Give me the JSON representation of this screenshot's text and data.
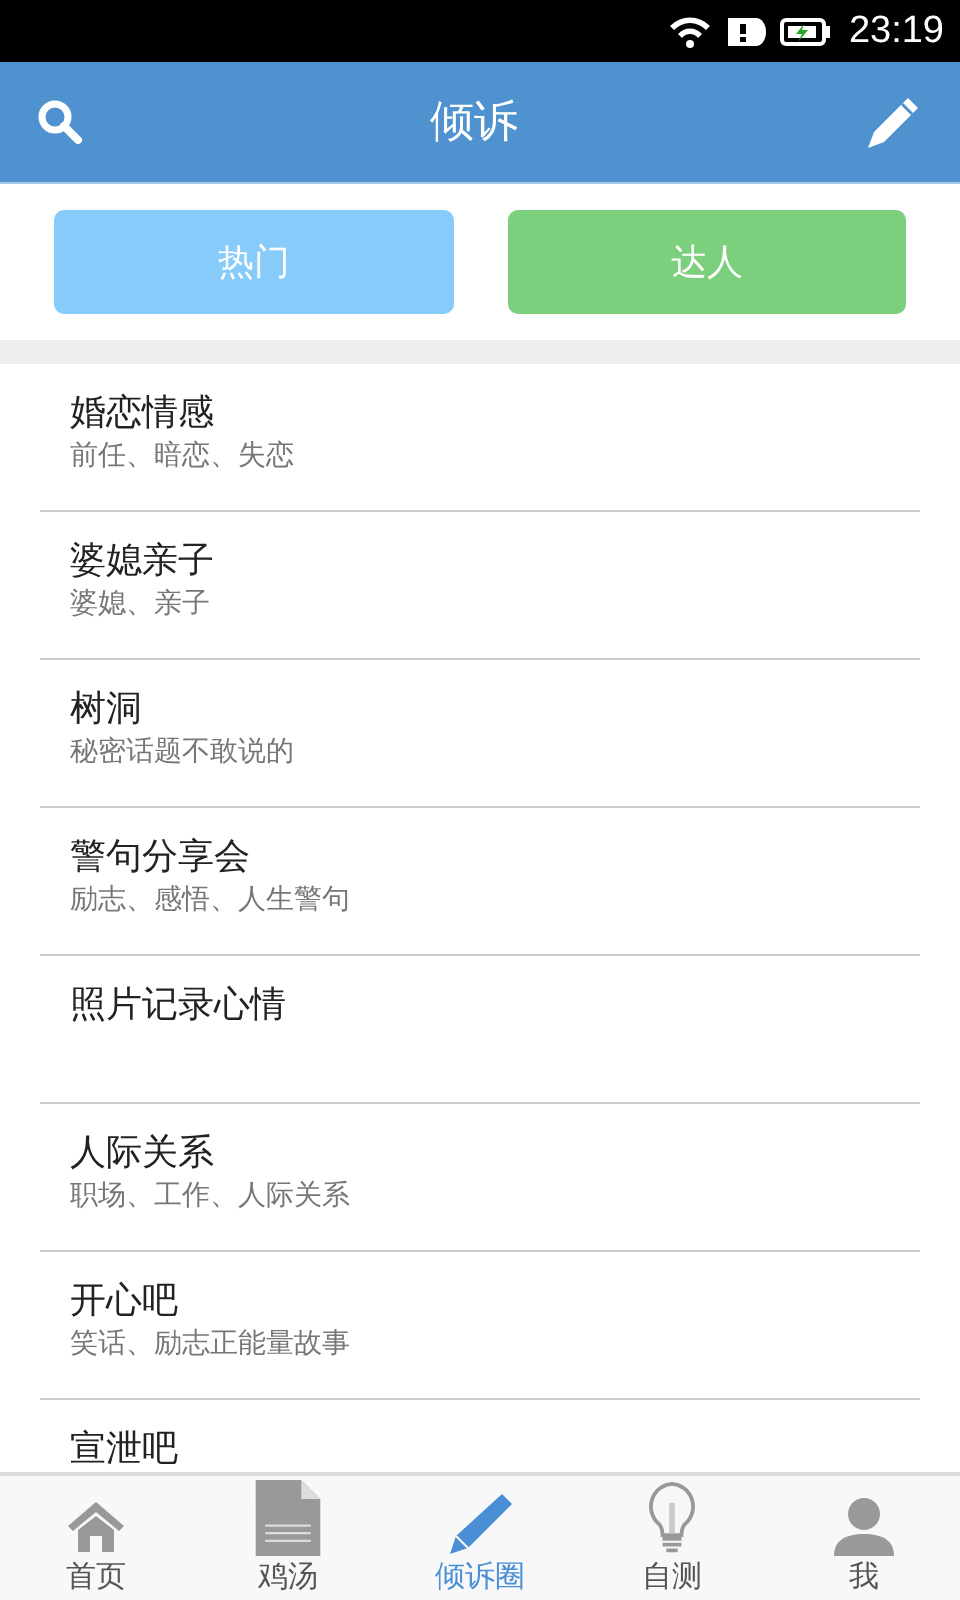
{
  "status_bar": {
    "time": "23:19"
  },
  "header": {
    "title": "倾诉"
  },
  "segments": [
    {
      "label": "热门",
      "color": "#87cbfb"
    },
    {
      "label": "达人",
      "color": "#7ccf7c"
    }
  ],
  "topics": [
    {
      "title": "婚恋情感",
      "subtitle": "前任、暗恋、失恋"
    },
    {
      "title": "婆媳亲子",
      "subtitle": "婆媳、亲子"
    },
    {
      "title": "树洞",
      "subtitle": "秘密话题不敢说的"
    },
    {
      "title": "警句分享会",
      "subtitle": "励志、感悟、人生警句"
    },
    {
      "title": "照片记录心情"
    },
    {
      "title": "人际关系",
      "subtitle": "职场、工作、人际关系"
    },
    {
      "title": "开心吧",
      "subtitle": "笑话、励志正能量故事"
    },
    {
      "title": "宣泄吧"
    }
  ],
  "tabs": [
    {
      "label": "首页",
      "kind": "home",
      "selected": false
    },
    {
      "label": "鸡汤",
      "kind": "document",
      "selected": false
    },
    {
      "label": "倾诉圈",
      "kind": "pencil",
      "selected": true
    },
    {
      "label": "自测",
      "kind": "bulb",
      "selected": false
    },
    {
      "label": "我",
      "kind": "person",
      "selected": false
    }
  ]
}
